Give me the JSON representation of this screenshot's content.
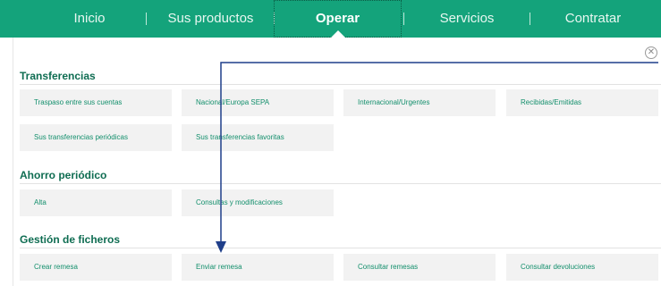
{
  "nav": {
    "items": [
      "Inicio",
      "Sus productos",
      "Operar",
      "Servicios",
      "Contratar"
    ],
    "active": "Operar"
  },
  "close_icon": "close-circle-icon",
  "sections": [
    {
      "title": "Transferencias",
      "rows": [
        [
          "Traspaso entre sus cuentas",
          "Nacional/Europa SEPA",
          "Internacional/Urgentes",
          "Recibidas/Emitidas"
        ],
        [
          "Sus transferencias periódicas",
          "Sus transferencias favoritas"
        ]
      ]
    },
    {
      "title": "Ahorro periódico",
      "rows": [
        [
          "Alta",
          "Consultas y modificaciones"
        ]
      ]
    },
    {
      "title": "Gestión de ficheros",
      "rows": [
        [
          "Crear remesa",
          "Enviar remesa",
          "Consultar remesas",
          "Consultar devoluciones"
        ]
      ]
    }
  ],
  "colors": {
    "nav_bg": "#14a37b",
    "heading": "#0f6d52",
    "tile_bg": "#f2f2f2",
    "tile_text": "#138f6c",
    "annotation_arrow": "#1f3f8a"
  }
}
